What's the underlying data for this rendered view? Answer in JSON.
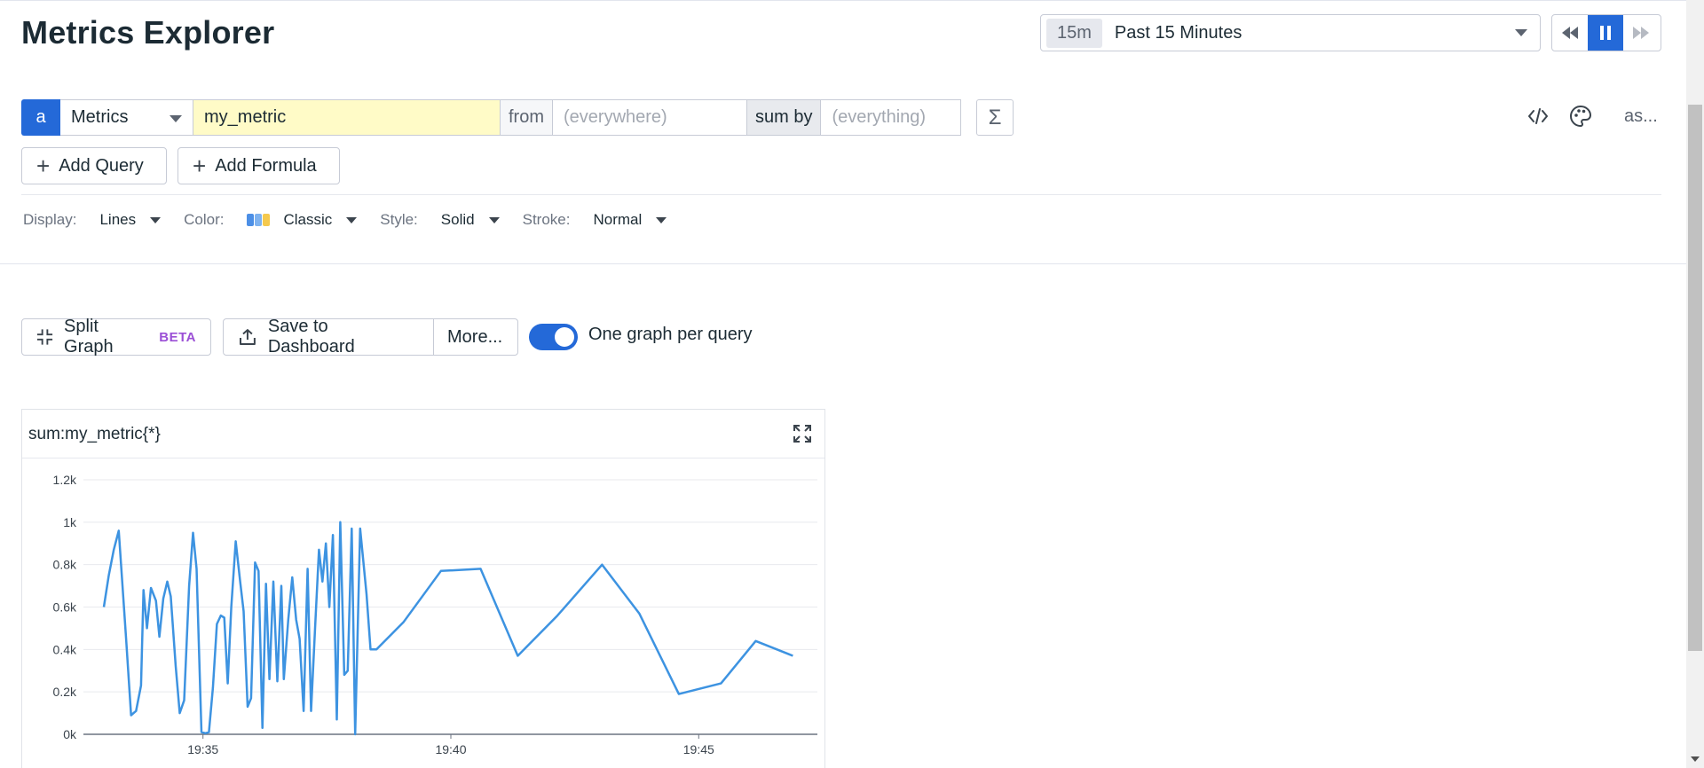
{
  "header": {
    "title": "Metrics Explorer",
    "time_badge": "15m",
    "time_label": "Past 15 Minutes"
  },
  "query": {
    "letter": "a",
    "source": "Metrics",
    "metric": "my_metric",
    "from_label": "from",
    "from_placeholder": "(everywhere)",
    "sumby_label": "sum by",
    "sumby_placeholder": "(everything)",
    "sigma": "Σ",
    "as_label": "as..."
  },
  "buttons": {
    "add_query": "Add Query",
    "add_formula": "Add Formula",
    "split_graph": "Split Graph",
    "beta": "BETA",
    "save_dashboard": "Save to Dashboard",
    "more": "More...",
    "one_graph": "One graph per query"
  },
  "display": {
    "display_label": "Display:",
    "display_value": "Lines",
    "color_label": "Color:",
    "color_value": "Classic",
    "style_label": "Style:",
    "style_value": "Solid",
    "stroke_label": "Stroke:",
    "stroke_value": "Normal"
  },
  "toggle": {
    "one_graph_per_query": true
  },
  "widget": {
    "title": "sum:my_metric{*}"
  },
  "colors": {
    "accent": "#2469d8",
    "series": "#3d93e1",
    "highlight": "#fffbc7",
    "beta": "#9b4fd6"
  },
  "chart_data": {
    "type": "line",
    "ylim": [
      0,
      1200
    ],
    "yticks": [
      "0k",
      "0.2k",
      "0.4k",
      "0.6k",
      "0.8k",
      "1k",
      "1.2k"
    ],
    "xticks": [
      {
        "label": "19:35",
        "t": 2.0
      },
      {
        "label": "19:40",
        "t": 7.0
      },
      {
        "label": "19:45",
        "t": 12.0
      }
    ],
    "xlim": [
      0,
      14.0
    ],
    "series": [
      {
        "values": [
          [
            0.0,
            600
          ],
          [
            0.1,
            750
          ],
          [
            0.2,
            870
          ],
          [
            0.3,
            960
          ],
          [
            0.45,
            450
          ],
          [
            0.55,
            90
          ],
          [
            0.65,
            110
          ],
          [
            0.75,
            230
          ],
          [
            0.8,
            680
          ],
          [
            0.87,
            500
          ],
          [
            0.95,
            690
          ],
          [
            1.05,
            630
          ],
          [
            1.12,
            460
          ],
          [
            1.2,
            640
          ],
          [
            1.28,
            720
          ],
          [
            1.35,
            650
          ],
          [
            1.45,
            320
          ],
          [
            1.53,
            100
          ],
          [
            1.62,
            160
          ],
          [
            1.72,
            700
          ],
          [
            1.8,
            950
          ],
          [
            1.87,
            780
          ],
          [
            1.97,
            10
          ],
          [
            2.05,
            5
          ],
          [
            2.12,
            10
          ],
          [
            2.2,
            220
          ],
          [
            2.28,
            520
          ],
          [
            2.36,
            560
          ],
          [
            2.43,
            550
          ],
          [
            2.5,
            240
          ],
          [
            2.57,
            600
          ],
          [
            2.66,
            910
          ],
          [
            2.75,
            720
          ],
          [
            2.82,
            580
          ],
          [
            2.9,
            130
          ],
          [
            2.97,
            170
          ],
          [
            3.05,
            810
          ],
          [
            3.12,
            770
          ],
          [
            3.2,
            30
          ],
          [
            3.27,
            710
          ],
          [
            3.34,
            260
          ],
          [
            3.42,
            720
          ],
          [
            3.5,
            250
          ],
          [
            3.58,
            700
          ],
          [
            3.63,
            260
          ],
          [
            3.72,
            540
          ],
          [
            3.8,
            740
          ],
          [
            3.88,
            540
          ],
          [
            3.95,
            450
          ],
          [
            4.03,
            110
          ],
          [
            4.11,
            780
          ],
          [
            4.18,
            110
          ],
          [
            4.26,
            500
          ],
          [
            4.34,
            870
          ],
          [
            4.41,
            720
          ],
          [
            4.48,
            900
          ],
          [
            4.55,
            600
          ],
          [
            4.62,
            940
          ],
          [
            4.7,
            70
          ],
          [
            4.77,
            1000
          ],
          [
            4.85,
            280
          ],
          [
            4.92,
            300
          ],
          [
            5.0,
            970
          ],
          [
            5.07,
            0
          ],
          [
            5.17,
            970
          ],
          [
            5.3,
            660
          ],
          [
            5.38,
            400
          ],
          [
            5.5,
            400
          ],
          [
            6.05,
            530
          ],
          [
            6.8,
            770
          ],
          [
            7.6,
            780
          ],
          [
            8.35,
            370
          ],
          [
            9.15,
            560
          ],
          [
            10.05,
            800
          ],
          [
            10.8,
            570
          ],
          [
            11.6,
            190
          ],
          [
            12.45,
            240
          ],
          [
            13.15,
            440
          ],
          [
            13.9,
            370
          ]
        ]
      }
    ]
  }
}
